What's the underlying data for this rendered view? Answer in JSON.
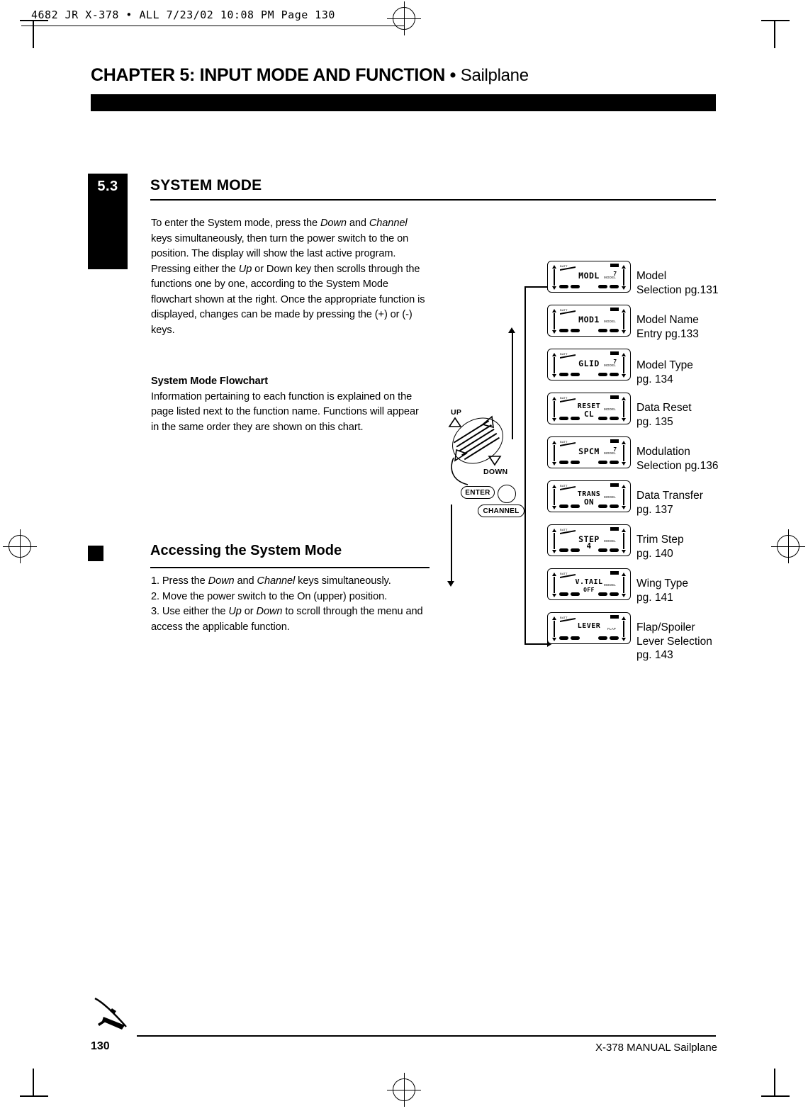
{
  "slug": {
    "text": "4682 JR X-378 • ALL  7/23/02  10:08 PM  Page 130"
  },
  "header": {
    "chapter_main": "CHAPTER 5: INPUT MODE AND FUNCTION",
    "chapter_sep": " • ",
    "chapter_sub": "Sailplane"
  },
  "section": {
    "number": "5.3",
    "title": "SYSTEM MODE",
    "intro_html": "To enter the System mode, press the <i>Down</i> and <i>Channel</i> keys simultaneously, then turn the power switch to the on position. The display will show the last active program. Pressing either the <i>Up</i> or Down key then scrolls through the functions one by one, according to the System Mode flowchart shown at the right. Once the appropriate function is displayed, changes can be made by pressing the (+) or (-) keys.",
    "flowchart_heading": "System Mode Flowchart",
    "flowchart_text": "Information pertaining to each function is explained on the page listed next to the function name. Functions will appear in the same order they are shown on this chart."
  },
  "accessing": {
    "title": "Accessing the System Mode",
    "steps_html": "1. Press the <i>Down</i> and <i>Channel</i> keys simultaneously.<br>2. Move the power switch to the On (upper) position.<br>3. Use either the <i>Up</i> or <i>Down</i> to scroll through the menu and access the applicable function."
  },
  "controls": {
    "up_label": "UP",
    "down_label": "DOWN",
    "enter_label": "ENTER",
    "channel_label": "CHANNEL"
  },
  "flowchart": {
    "steps": [
      {
        "lcd_main": "MODL",
        "lcd_sub": "",
        "lcd_corner_right": "MODEL",
        "lcd_num": "7",
        "label": "Model\nSelection pg.131"
      },
      {
        "lcd_main": "MOD1",
        "lcd_sub": "",
        "lcd_corner_right": "MODEL",
        "lcd_num": "",
        "label": "Model Name\nEntry pg.133"
      },
      {
        "lcd_main": "GLID",
        "lcd_sub": "",
        "lcd_corner_right": "MODEL",
        "lcd_num": "7",
        "label": "Model Type\npg. 134"
      },
      {
        "lcd_main": "RESET",
        "lcd_sub": "CL",
        "lcd_corner_right": "MODEL",
        "lcd_num": "",
        "label": "Data Reset\npg. 135"
      },
      {
        "lcd_main": "SPCM",
        "lcd_sub": "",
        "lcd_corner_right": "MODEL",
        "lcd_num": "7",
        "label": "Modulation\nSelection pg.136"
      },
      {
        "lcd_main": "TRANS",
        "lcd_sub": "ON",
        "lcd_corner_right": "MODEL",
        "lcd_num": "",
        "label": "Data Transfer\npg. 137"
      },
      {
        "lcd_main": "STEP",
        "lcd_sub": "4",
        "lcd_corner_right": "MODEL",
        "lcd_num": "",
        "label": "Trim Step\npg. 140"
      },
      {
        "lcd_main": "V.TAIL",
        "lcd_sub": "OFF",
        "lcd_corner_right": "MODEL",
        "lcd_num": "",
        "label": "Wing Type\npg. 141"
      },
      {
        "lcd_main": "LEVER",
        "lcd_sub": "",
        "lcd_corner_right": "FLAP",
        "lcd_num": "",
        "label": "Flap/Spoiler\nLever Selection\npg. 143"
      }
    ]
  },
  "footer": {
    "page_number": "130",
    "manual_text": "X-378 MANUAL  Sailplane"
  }
}
